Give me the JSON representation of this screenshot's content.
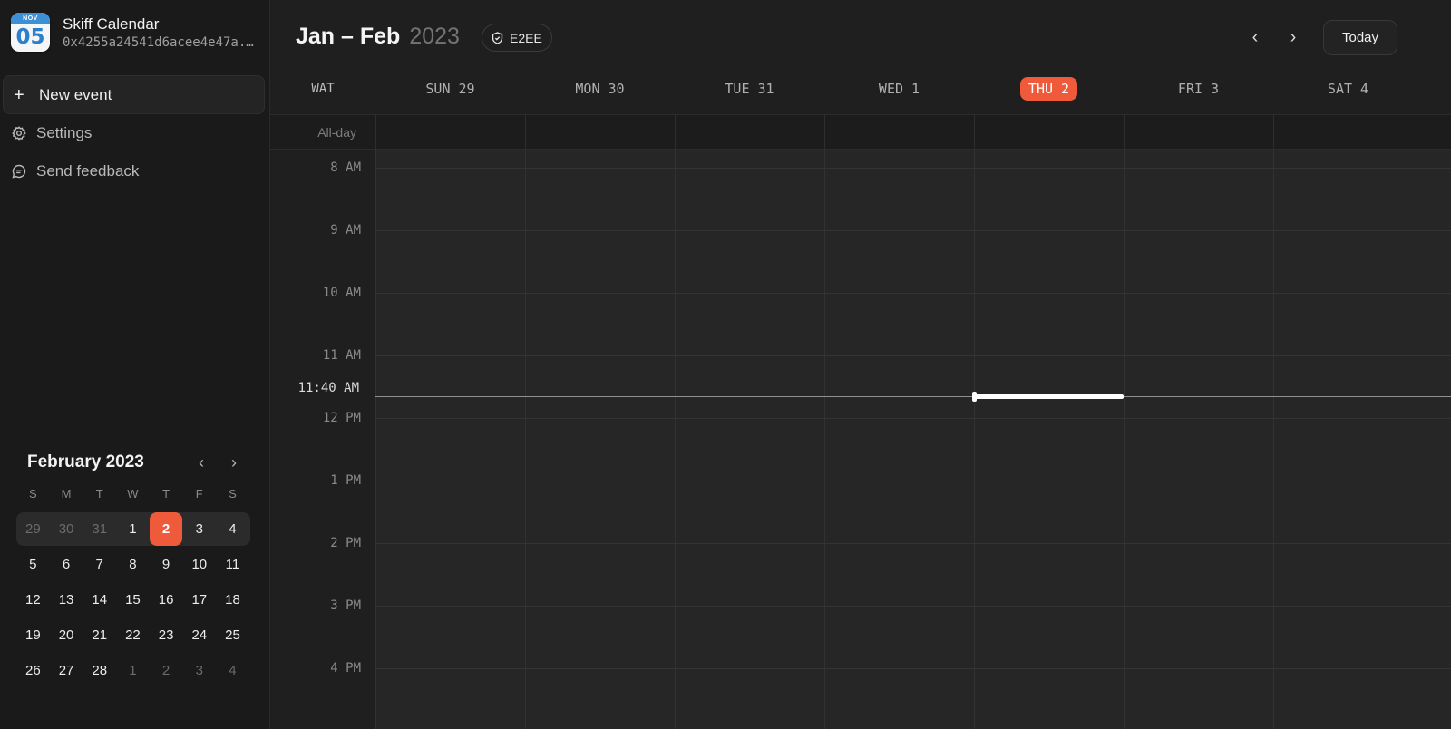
{
  "app": {
    "name": "Skiff Calendar",
    "address": "0x4255a24541d6acee4e47a...",
    "logo_month": "NOV",
    "logo_day": "05"
  },
  "sidebar": {
    "new_event": "New event",
    "settings": "Settings",
    "feedback": "Send feedback"
  },
  "mini_calendar": {
    "title": "February 2023",
    "prev": "‹",
    "next": "›",
    "weekdays": [
      "S",
      "M",
      "T",
      "W",
      "T",
      "F",
      "S"
    ],
    "weeks": [
      [
        "29",
        "30",
        "31",
        "1",
        "2",
        "3",
        "4"
      ],
      [
        "5",
        "6",
        "7",
        "8",
        "9",
        "10",
        "11"
      ],
      [
        "12",
        "13",
        "14",
        "15",
        "16",
        "17",
        "18"
      ],
      [
        "19",
        "20",
        "21",
        "22",
        "23",
        "24",
        "25"
      ],
      [
        "26",
        "27",
        "28",
        "1",
        "2",
        "3",
        "4"
      ]
    ],
    "selected": "2"
  },
  "header": {
    "range": "Jan – Feb",
    "year": "2023",
    "badge": "E2EE",
    "prev": "‹",
    "next": "›",
    "today": "Today"
  },
  "week": {
    "timezone": "WAT",
    "days": [
      "SUN 29",
      "MON 30",
      "TUE 31",
      "WED 1",
      "THU 2",
      "FRI 3",
      "SAT 4"
    ],
    "today_index": 4,
    "all_day": "All-day",
    "hours": [
      "8 AM",
      "9 AM",
      "10 AM",
      "11 AM",
      "12 PM",
      "1 PM",
      "2 PM",
      "3 PM",
      "4 PM"
    ],
    "now": "11:40 AM"
  },
  "colors": {
    "accent": "#ef5a3a",
    "background": "#1f1f1f",
    "sidebar": "#1a1a1a"
  }
}
